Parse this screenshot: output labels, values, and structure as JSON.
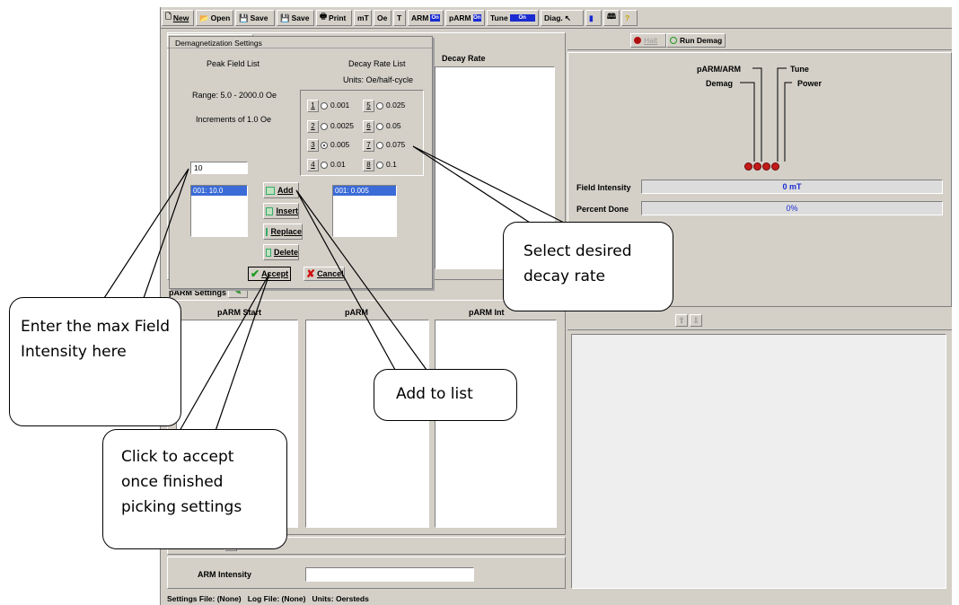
{
  "toolbar": {
    "new": "New",
    "open": "Open",
    "save": "Save",
    "save2": "Save",
    "print": "Print",
    "mt": "mT",
    "oe": "Oe",
    "t": "T",
    "arm": "ARM",
    "parm": "pARM",
    "tune": "Tune",
    "diag": "Diag.",
    "mini_on": "On"
  },
  "dialog": {
    "title": "Demagnetization Settings",
    "peak_field_list": "Peak Field List",
    "decay_rate_list": "Decay Rate List",
    "units": "Units: Oe/half-cycle",
    "range": "Range: 5.0 - 2000.0 Oe",
    "increments": "Increments of 1.0 Oe",
    "field_input": "10",
    "field_list": [
      "001: 10.0"
    ],
    "decay_list": [
      "001: 0.005"
    ],
    "rates": [
      {
        "num": "1",
        "value": "0.001",
        "selected": false
      },
      {
        "num": "2",
        "value": "0.0025",
        "selected": false
      },
      {
        "num": "3",
        "value": "0.005",
        "selected": true
      },
      {
        "num": "4",
        "value": "0.01",
        "selected": false
      },
      {
        "num": "5",
        "value": "0.025",
        "selected": false
      },
      {
        "num": "6",
        "value": "0.05",
        "selected": false
      },
      {
        "num": "7",
        "value": "0.075",
        "selected": false
      },
      {
        "num": "8",
        "value": "0.1",
        "selected": false
      }
    ],
    "buttons": {
      "add": "Add",
      "insert": "Insert",
      "replace": "Replace",
      "delete": "Delete",
      "accept": "Accept",
      "cancel": "Cancel"
    }
  },
  "main": {
    "decay_rate_header": "Decay Rate",
    "parm_settings": "pARM Settings",
    "parm_start": "pARM Start",
    "parm_mid": "pARM",
    "parm_int": "pARM Int",
    "arm_intensity": "ARM Intensity"
  },
  "right": {
    "halt": "Halt",
    "run_demag": "Run Demag",
    "parm_arm": "pARM/ARM",
    "tune": "Tune",
    "demag": "Demag",
    "power": "Power",
    "field_intensity_label": "Field Intensity",
    "field_intensity_value": "0 mT",
    "percent_done_label": "Percent Done",
    "percent_done_value": "0%"
  },
  "status": {
    "settings_file": "Settings File: (None)",
    "log_file": "Log File: (None)",
    "units": "Units: Oersteds"
  },
  "callouts": {
    "max_field": "Enter the max Field Intensity here",
    "decay": "Select desired decay rate",
    "add": "Add to list",
    "accept": "Click to accept once finished picking settings"
  },
  "colors": {
    "window_gray": "#d4d0c8",
    "selection_blue": "#3b6bd6",
    "led_red": "#c41a1a",
    "value_blue": "#1a2bd1"
  }
}
